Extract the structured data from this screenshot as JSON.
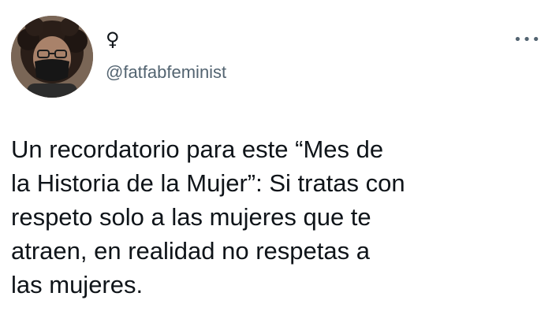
{
  "tweet": {
    "display_name": "♀",
    "handle": "@fatfabfeminist",
    "text": "Un recordatorio para este “Mes de\nla Historia de la Mujer”: Si tratas con\nrespeto solo a las mujeres que te\natraen, en realidad no respetas a\nlas mujeres.",
    "more_icon": "more-horizontal-icon",
    "avatar_icon": "profile-photo"
  },
  "colors": {
    "text": "#0f1419",
    "secondary": "#536471",
    "background": "#ffffff"
  }
}
